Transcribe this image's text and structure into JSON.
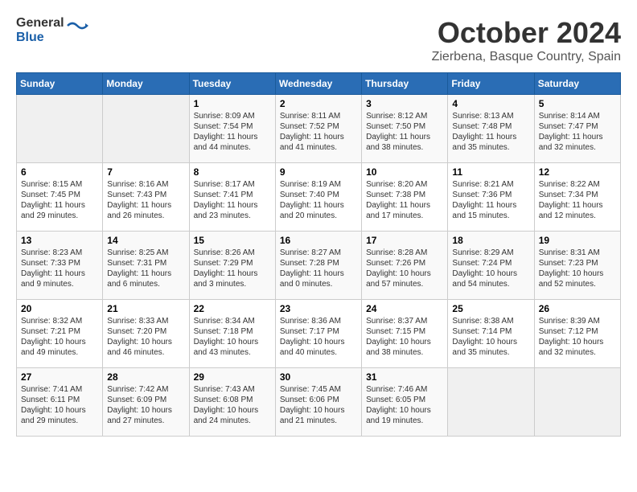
{
  "logo": {
    "general": "General",
    "blue": "Blue"
  },
  "title": {
    "month": "October 2024",
    "location": "Zierbena, Basque Country, Spain"
  },
  "headers": [
    "Sunday",
    "Monday",
    "Tuesday",
    "Wednesday",
    "Thursday",
    "Friday",
    "Saturday"
  ],
  "weeks": [
    [
      {
        "day": "",
        "info": ""
      },
      {
        "day": "",
        "info": ""
      },
      {
        "day": "1",
        "info": "Sunrise: 8:09 AM\nSunset: 7:54 PM\nDaylight: 11 hours and 44 minutes."
      },
      {
        "day": "2",
        "info": "Sunrise: 8:11 AM\nSunset: 7:52 PM\nDaylight: 11 hours and 41 minutes."
      },
      {
        "day": "3",
        "info": "Sunrise: 8:12 AM\nSunset: 7:50 PM\nDaylight: 11 hours and 38 minutes."
      },
      {
        "day": "4",
        "info": "Sunrise: 8:13 AM\nSunset: 7:48 PM\nDaylight: 11 hours and 35 minutes."
      },
      {
        "day": "5",
        "info": "Sunrise: 8:14 AM\nSunset: 7:47 PM\nDaylight: 11 hours and 32 minutes."
      }
    ],
    [
      {
        "day": "6",
        "info": "Sunrise: 8:15 AM\nSunset: 7:45 PM\nDaylight: 11 hours and 29 minutes."
      },
      {
        "day": "7",
        "info": "Sunrise: 8:16 AM\nSunset: 7:43 PM\nDaylight: 11 hours and 26 minutes."
      },
      {
        "day": "8",
        "info": "Sunrise: 8:17 AM\nSunset: 7:41 PM\nDaylight: 11 hours and 23 minutes."
      },
      {
        "day": "9",
        "info": "Sunrise: 8:19 AM\nSunset: 7:40 PM\nDaylight: 11 hours and 20 minutes."
      },
      {
        "day": "10",
        "info": "Sunrise: 8:20 AM\nSunset: 7:38 PM\nDaylight: 11 hours and 17 minutes."
      },
      {
        "day": "11",
        "info": "Sunrise: 8:21 AM\nSunset: 7:36 PM\nDaylight: 11 hours and 15 minutes."
      },
      {
        "day": "12",
        "info": "Sunrise: 8:22 AM\nSunset: 7:34 PM\nDaylight: 11 hours and 12 minutes."
      }
    ],
    [
      {
        "day": "13",
        "info": "Sunrise: 8:23 AM\nSunset: 7:33 PM\nDaylight: 11 hours and 9 minutes."
      },
      {
        "day": "14",
        "info": "Sunrise: 8:25 AM\nSunset: 7:31 PM\nDaylight: 11 hours and 6 minutes."
      },
      {
        "day": "15",
        "info": "Sunrise: 8:26 AM\nSunset: 7:29 PM\nDaylight: 11 hours and 3 minutes."
      },
      {
        "day": "16",
        "info": "Sunrise: 8:27 AM\nSunset: 7:28 PM\nDaylight: 11 hours and 0 minutes."
      },
      {
        "day": "17",
        "info": "Sunrise: 8:28 AM\nSunset: 7:26 PM\nDaylight: 10 hours and 57 minutes."
      },
      {
        "day": "18",
        "info": "Sunrise: 8:29 AM\nSunset: 7:24 PM\nDaylight: 10 hours and 54 minutes."
      },
      {
        "day": "19",
        "info": "Sunrise: 8:31 AM\nSunset: 7:23 PM\nDaylight: 10 hours and 52 minutes."
      }
    ],
    [
      {
        "day": "20",
        "info": "Sunrise: 8:32 AM\nSunset: 7:21 PM\nDaylight: 10 hours and 49 minutes."
      },
      {
        "day": "21",
        "info": "Sunrise: 8:33 AM\nSunset: 7:20 PM\nDaylight: 10 hours and 46 minutes."
      },
      {
        "day": "22",
        "info": "Sunrise: 8:34 AM\nSunset: 7:18 PM\nDaylight: 10 hours and 43 minutes."
      },
      {
        "day": "23",
        "info": "Sunrise: 8:36 AM\nSunset: 7:17 PM\nDaylight: 10 hours and 40 minutes."
      },
      {
        "day": "24",
        "info": "Sunrise: 8:37 AM\nSunset: 7:15 PM\nDaylight: 10 hours and 38 minutes."
      },
      {
        "day": "25",
        "info": "Sunrise: 8:38 AM\nSunset: 7:14 PM\nDaylight: 10 hours and 35 minutes."
      },
      {
        "day": "26",
        "info": "Sunrise: 8:39 AM\nSunset: 7:12 PM\nDaylight: 10 hours and 32 minutes."
      }
    ],
    [
      {
        "day": "27",
        "info": "Sunrise: 7:41 AM\nSunset: 6:11 PM\nDaylight: 10 hours and 29 minutes."
      },
      {
        "day": "28",
        "info": "Sunrise: 7:42 AM\nSunset: 6:09 PM\nDaylight: 10 hours and 27 minutes."
      },
      {
        "day": "29",
        "info": "Sunrise: 7:43 AM\nSunset: 6:08 PM\nDaylight: 10 hours and 24 minutes."
      },
      {
        "day": "30",
        "info": "Sunrise: 7:45 AM\nSunset: 6:06 PM\nDaylight: 10 hours and 21 minutes."
      },
      {
        "day": "31",
        "info": "Sunrise: 7:46 AM\nSunset: 6:05 PM\nDaylight: 10 hours and 19 minutes."
      },
      {
        "day": "",
        "info": ""
      },
      {
        "day": "",
        "info": ""
      }
    ]
  ]
}
